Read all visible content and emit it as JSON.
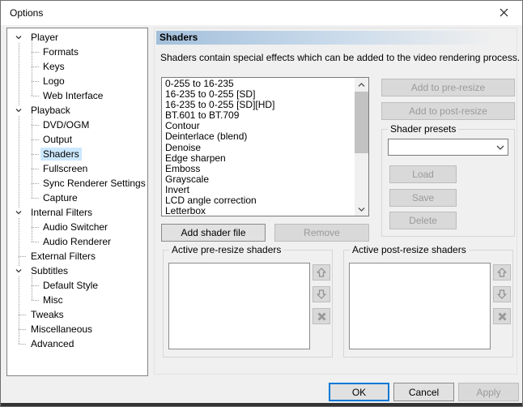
{
  "window": {
    "title": "Options"
  },
  "colors": {
    "accent": "#0078d7",
    "selection": "#cce8ff",
    "header_gradient_left": "#a3c0db",
    "dialog_bg": "#f0f0f0",
    "titlebar_bg": "#ffffff"
  },
  "tree": {
    "items": [
      {
        "label": "Player",
        "level": 0,
        "expanded": true
      },
      {
        "label": "Formats",
        "level": 1
      },
      {
        "label": "Keys",
        "level": 1
      },
      {
        "label": "Logo",
        "level": 1
      },
      {
        "label": "Web Interface",
        "level": 1
      },
      {
        "label": "Playback",
        "level": 0,
        "expanded": true
      },
      {
        "label": "DVD/OGM",
        "level": 1
      },
      {
        "label": "Output",
        "level": 1
      },
      {
        "label": "Shaders",
        "level": 1,
        "selected": true
      },
      {
        "label": "Fullscreen",
        "level": 1
      },
      {
        "label": "Sync Renderer Settings",
        "level": 1
      },
      {
        "label": "Capture",
        "level": 1
      },
      {
        "label": "Internal Filters",
        "level": 0,
        "expanded": true
      },
      {
        "label": "Audio Switcher",
        "level": 1
      },
      {
        "label": "Audio Renderer",
        "level": 1
      },
      {
        "label": "External Filters",
        "level": 0
      },
      {
        "label": "Subtitles",
        "level": 0,
        "expanded": true
      },
      {
        "label": "Default Style",
        "level": 1
      },
      {
        "label": "Misc",
        "level": 1
      },
      {
        "label": "Tweaks",
        "level": 0
      },
      {
        "label": "Miscellaneous",
        "level": 0
      },
      {
        "label": "Advanced",
        "level": 0
      }
    ]
  },
  "page": {
    "title": "Shaders",
    "description": "Shaders contain special effects which can be added to the video rendering process.",
    "shader_list": {
      "items": [
        "0-255 to 16-235",
        "16-235 to 0-255 [SD]",
        "16-235 to 0-255 [SD][HD]",
        "BT.601 to BT.709",
        "Contour",
        "Deinterlace (blend)",
        "Denoise",
        "Edge sharpen",
        "Emboss",
        "Grayscale",
        "Invert",
        "LCD angle correction",
        "Letterbox"
      ]
    },
    "buttons": {
      "add_pre": "Add to pre-resize",
      "add_post": "Add to post-resize",
      "add_file": "Add shader file",
      "remove": "Remove"
    },
    "presets": {
      "title": "Shader presets",
      "combo_value": "",
      "load": "Load",
      "save": "Save",
      "delete": "Delete"
    },
    "pre_group": {
      "title": "Active pre-resize shaders",
      "items": []
    },
    "post_group": {
      "title": "Active post-resize shaders",
      "items": []
    }
  },
  "footer": {
    "ok": "OK",
    "cancel": "Cancel",
    "apply": "Apply"
  }
}
